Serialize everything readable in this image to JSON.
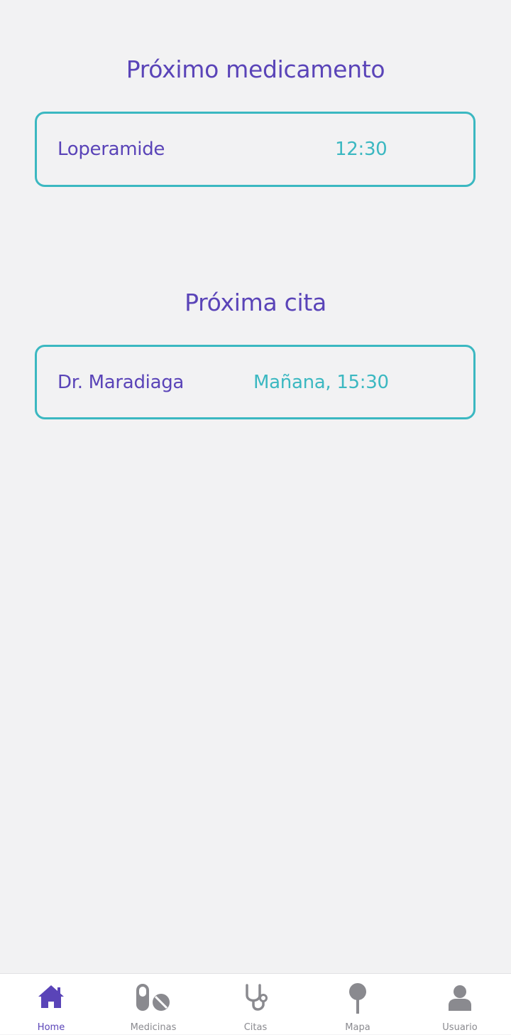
{
  "next_medication": {
    "title": "Próximo medicamento",
    "name": "Loperamide",
    "time": "12:30"
  },
  "next_appointment": {
    "title": "Próxima cita",
    "doctor": "Dr. Maradiaga",
    "time": "Mañana, 15:30"
  },
  "colors": {
    "primary": "#5a44b8",
    "accent": "#3bb8c1",
    "inactive": "#8a8a8f",
    "background": "#f2f2f3"
  },
  "bottom_nav": {
    "items": [
      {
        "label": "Home",
        "icon": "home-icon",
        "active": true
      },
      {
        "label": "Medicinas",
        "icon": "pills-icon",
        "active": false
      },
      {
        "label": "Citas",
        "icon": "stethoscope-icon",
        "active": false
      },
      {
        "label": "Mapa",
        "icon": "map-pin-icon",
        "active": false
      },
      {
        "label": "Usuario",
        "icon": "user-icon",
        "active": false
      }
    ]
  }
}
